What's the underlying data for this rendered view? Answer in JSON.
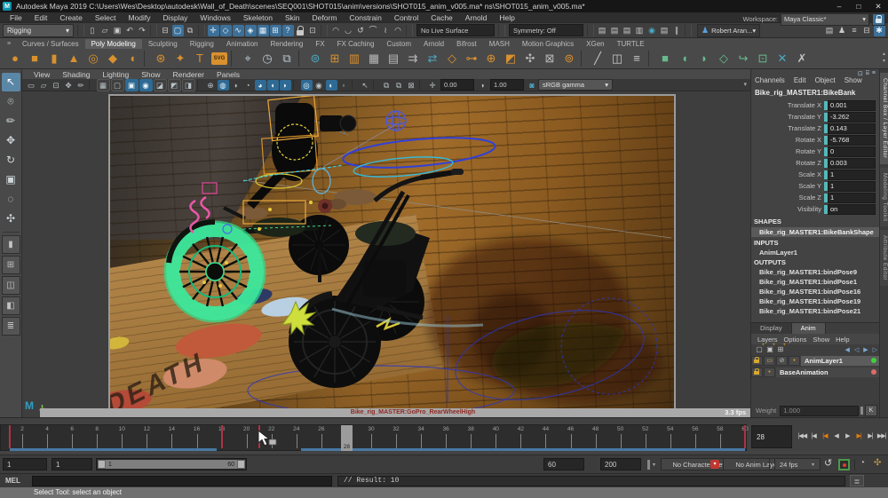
{
  "window": {
    "title": "Autodesk Maya 2019 C:\\Users\\Wes\\Desktop\\autodesk\\Wall_of_Death\\scenes\\SEQ001\\SHOT015\\anim\\versions\\SHOT015_anim_v005.ma*   ns\\SHOT015_anim_v005.ma*",
    "logo_letter": "M",
    "controls": {
      "minimize": "–",
      "maximize": "□",
      "close": "✕"
    }
  },
  "menu_bar": {
    "items": [
      "File",
      "Edit",
      "Create",
      "Select",
      "Modify",
      "Display",
      "Windows",
      "Skeleton",
      "Skin",
      "Deform",
      "Constrain",
      "Control",
      "Cache",
      "Arnold",
      "Help"
    ]
  },
  "workspace": {
    "label": "Workspace:",
    "value": "Maya Classic*",
    "caret": "▾",
    "lock_glyph": "⊓"
  },
  "status_line": {
    "items": [
      {
        "k": "dropdown",
        "name": "menu-set-dropdown",
        "text": "Rigging",
        "w": 70
      },
      {
        "k": "div"
      },
      {
        "k": "icon",
        "name": "new-scene-icon",
        "g": "▯"
      },
      {
        "k": "icon",
        "name": "open-scene-icon",
        "g": "▱"
      },
      {
        "k": "icon",
        "name": "save-scene-icon",
        "g": "▣"
      },
      {
        "k": "icon",
        "name": "undo-icon",
        "g": "↶"
      },
      {
        "k": "icon",
        "name": "redo-icon",
        "g": "↷"
      },
      {
        "k": "div"
      },
      {
        "k": "icon",
        "name": "select-hierarchy-icon",
        "g": "⊟"
      },
      {
        "k": "icon",
        "name": "select-object-icon",
        "g": "▢",
        "active": true
      },
      {
        "k": "icon",
        "name": "select-component-icon",
        "g": "⧉"
      },
      {
        "k": "div"
      },
      {
        "k": "icon",
        "name": "snap-grid-icon",
        "g": "✛",
        "active": true
      },
      {
        "k": "icon",
        "name": "snap-curve-icon",
        "g": "◇",
        "active": true
      },
      {
        "k": "icon",
        "name": "snap-point-icon",
        "g": "∿",
        "active": true
      },
      {
        "k": "icon",
        "name": "snap-plane-icon",
        "g": "◈",
        "active": true
      },
      {
        "k": "icon",
        "name": "snap-view-icon",
        "g": "▦",
        "active": true
      },
      {
        "k": "icon",
        "name": "snap-center-icon",
        "g": "⊞",
        "active": true
      },
      {
        "k": "icon",
        "name": "make-live-icon",
        "g": "?",
        "active": true
      },
      {
        "k": "lock",
        "name": "lock-selection-icon"
      },
      {
        "k": "icon",
        "name": "highlight-selection-icon",
        "g": "⊡"
      },
      {
        "k": "div"
      },
      {
        "k": "icon",
        "name": "construction-history-icon",
        "g": "◠"
      },
      {
        "k": "icon",
        "name": "curve-snap-icon",
        "g": "◡"
      },
      {
        "k": "icon",
        "name": "rebuild-curve-icon",
        "g": "↺"
      },
      {
        "k": "icon",
        "name": "arc-tool-icon",
        "g": "⌒"
      },
      {
        "k": "icon",
        "name": "wave-tool-icon",
        "g": "≀"
      },
      {
        "k": "icon",
        "name": "arch-tool-icon",
        "g": "◠"
      },
      {
        "k": "div"
      },
      {
        "k": "field",
        "name": "live-surface-field",
        "text": "No Live Surface",
        "w": 78
      },
      {
        "k": "div"
      },
      {
        "k": "field",
        "name": "symmetry-field",
        "text": "Symmetry: Off",
        "w": 74
      },
      {
        "k": "div"
      },
      {
        "k": "icon",
        "name": "render-icon",
        "g": "▤"
      },
      {
        "k": "icon",
        "name": "ipr-render-icon",
        "g": "▤"
      },
      {
        "k": "icon",
        "name": "render-settings-icon",
        "g": "▤"
      },
      {
        "k": "icon",
        "name": "hypershade-icon",
        "g": "▥"
      },
      {
        "k": "icon",
        "name": "render-view-sphere-icon",
        "g": "◉",
        "c": "#4aa9c4"
      },
      {
        "k": "icon",
        "name": "render-sequence-icon",
        "g": "▤"
      },
      {
        "k": "icon",
        "name": "pause-viewport-icon",
        "g": "∥"
      },
      {
        "k": "div"
      },
      {
        "k": "user",
        "name": "user-account-chip",
        "text": "Robert Aran...",
        "caret": "▾"
      },
      {
        "k": "flex"
      },
      {
        "k": "icon",
        "name": "outliner-toggle-icon",
        "g": "▤"
      },
      {
        "k": "icon",
        "name": "character-controls-icon",
        "g": "♟"
      },
      {
        "k": "icon",
        "name": "sliders-toggle-icon",
        "g": "≡"
      },
      {
        "k": "icon",
        "name": "layout-toggle-icon",
        "g": "⊟"
      },
      {
        "k": "icon",
        "name": "settings-toggle-icon",
        "g": "✱",
        "active": true
      }
    ]
  },
  "shelf": {
    "burger": "≡",
    "tabs": [
      "Curves / Surfaces",
      "Poly Modeling",
      "Sculpting",
      "Rigging",
      "Animation",
      "Rendering",
      "FX",
      "FX Caching",
      "Custom",
      "Arnold",
      "Bifrost",
      "MASH",
      "Motion Graphics",
      "XGen",
      "TURTLE"
    ],
    "active_tab": "Poly Modeling",
    "scroll_up": "▴",
    "scroll_down": "▾",
    "icons": [
      {
        "n": "poly-sphere-icon",
        "g": "●",
        "c": "#d9912f"
      },
      {
        "n": "poly-cube-icon",
        "g": "■",
        "c": "#d9912f"
      },
      {
        "n": "poly-cylinder-icon",
        "g": "▮",
        "c": "#d9912f"
      },
      {
        "n": "poly-cone-icon",
        "g": "▲",
        "c": "#d9912f"
      },
      {
        "n": "poly-torus-icon",
        "g": "◎",
        "c": "#d9912f"
      },
      {
        "n": "poly-plane-icon",
        "g": "◆",
        "c": "#d9912f"
      },
      {
        "n": "poly-disc-icon",
        "g": "◖",
        "c": "#d9912f"
      },
      {
        "n": "div"
      },
      {
        "n": "platonic-solid-icon",
        "g": "⊛",
        "c": "#d9912f"
      },
      {
        "n": "super-shape-icon",
        "g": "✦",
        "c": "#d9912f"
      },
      {
        "n": "poly-text-icon",
        "g": "T",
        "c": "#d9912f"
      },
      {
        "n": "svg-tool-icon",
        "g": "SVG",
        "badge": true
      },
      {
        "n": "div"
      },
      {
        "n": "construction-plane-icon",
        "g": "⌖",
        "c": "#b8c4cc"
      },
      {
        "n": "snap-time-icon",
        "g": "◷",
        "c": "#b8c4cc"
      },
      {
        "n": "lattice-icon",
        "g": "⧉",
        "c": "#b8c4cc"
      },
      {
        "n": "div"
      },
      {
        "n": "sweep-mesh-icon",
        "g": "⊜",
        "c": "#4aa9c4"
      },
      {
        "n": "quad-draw-icon",
        "g": "⊞",
        "c": "#d9912f"
      },
      {
        "n": "barrel-icon",
        "g": "▥",
        "c": "#d9912f"
      },
      {
        "n": "grid-icon",
        "g": "▦",
        "c": "#b8b8b8"
      },
      {
        "n": "grid-alt-icon",
        "g": "▤",
        "c": "#b8b8b8"
      },
      {
        "n": "uv-icon",
        "g": "⇉",
        "c": "#b8b8b8"
      },
      {
        "n": "mirror-icon",
        "g": "⇄",
        "c": "#4aa9c4"
      },
      {
        "n": "cube-wire-icon",
        "g": "◇",
        "c": "#d9912f"
      },
      {
        "n": "network-icon",
        "g": "⊶",
        "c": "#d9912f"
      },
      {
        "n": "web-icon",
        "g": "⊕",
        "c": "#d9912f"
      },
      {
        "n": "corner-arrow-icon",
        "g": "◩",
        "c": "#d9912f"
      },
      {
        "n": "fan-icon",
        "g": "✣",
        "c": "#b8b8b8"
      },
      {
        "n": "crate-icon",
        "g": "⊠",
        "c": "#b8b8b8"
      },
      {
        "n": "pixel-ball-icon",
        "g": "⊚",
        "c": "#d9912f"
      },
      {
        "n": "div"
      },
      {
        "n": "pencil-line-icon",
        "g": "╱",
        "c": "#c8c8c8"
      },
      {
        "n": "retopo-icon",
        "g": "◫",
        "c": "#c8c8c8"
      },
      {
        "n": "pen-detail-icon",
        "g": "≡",
        "c": "#c8c8c8"
      },
      {
        "n": "div"
      },
      {
        "n": "boolean-union-icon",
        "g": "■",
        "c": "#67b98e"
      },
      {
        "n": "boolean-difference-icon",
        "g": "◖",
        "c": "#67b98e"
      },
      {
        "n": "boolean-intersect-icon",
        "g": "◗",
        "c": "#67b98e"
      },
      {
        "n": "boolean-cube-icon",
        "g": "◇",
        "c": "#67b98e"
      },
      {
        "n": "bend-arrow-icon",
        "g": "↪",
        "c": "#67b98e"
      },
      {
        "n": "framed-square-icon",
        "g": "⊡",
        "c": "#67b98e"
      },
      {
        "n": "multi-cut-icon",
        "g": "✕",
        "c": "#4aa9c4"
      },
      {
        "n": "delete-edge-icon",
        "g": "✗",
        "c": "#c0c0c0"
      }
    ]
  },
  "toolbox": {
    "tools": [
      {
        "name": "select-tool",
        "g": "↖",
        "active": true
      },
      {
        "name": "lasso-select-tool",
        "g": "⌾"
      },
      {
        "name": "paint-select-tool",
        "g": "✏"
      },
      {
        "name": "move-tool",
        "g": "✥"
      },
      {
        "name": "rotate-tool",
        "g": "↻"
      },
      {
        "name": "scale-tool",
        "g": "▣"
      },
      {
        "name": "soft-mod-tool",
        "g": "◌"
      },
      {
        "name": "joint-tool",
        "g": "✣"
      }
    ],
    "layouts": [
      {
        "name": "layout-single-pane",
        "g": "▮"
      },
      {
        "name": "layout-four-pane",
        "g": "⊞"
      },
      {
        "name": "layout-two-pane",
        "g": "◫"
      },
      {
        "name": "layout-outliner-persp",
        "g": "◧"
      },
      {
        "name": "layout-list",
        "g": "≣"
      }
    ]
  },
  "viewport": {
    "menus": [
      "View",
      "Shading",
      "Lighting",
      "Show",
      "Renderer",
      "Panels"
    ],
    "toolbar": [
      {
        "k": "icon",
        "name": "camera-lock-icon",
        "g": "▭"
      },
      {
        "k": "icon",
        "name": "bookmark-icon",
        "g": "▱"
      },
      {
        "k": "icon",
        "name": "image-plane-icon",
        "g": "⊡"
      },
      {
        "k": "icon",
        "name": "pan-zoom-icon",
        "g": "✥"
      },
      {
        "k": "icon",
        "name": "grease-pencil-icon",
        "g": "✏"
      },
      {
        "k": "div"
      },
      {
        "k": "icon",
        "name": "wireframe-mode-icon",
        "g": "▦",
        "boxed": true
      },
      {
        "k": "icon",
        "name": "shaded-mode-icon",
        "g": "▢",
        "boxed": true
      },
      {
        "k": "icon",
        "name": "textured-mode-icon",
        "g": "▣",
        "boxed": true,
        "active": true
      },
      {
        "k": "icon",
        "name": "lit-mode-icon",
        "g": "◉",
        "boxed": true,
        "active": true
      },
      {
        "k": "icon",
        "name": "shadows-mode-icon",
        "g": "◪",
        "boxed": true
      },
      {
        "k": "icon",
        "name": "ao-mode-icon",
        "g": "◩",
        "boxed": true
      },
      {
        "k": "icon",
        "name": "mb-mode-icon",
        "g": "◨",
        "boxed": true
      },
      {
        "k": "div"
      },
      {
        "k": "icon",
        "name": "default-material-icon",
        "g": "⊕"
      },
      {
        "k": "icon",
        "name": "wire-on-shaded-icon",
        "g": "◍",
        "active": true
      },
      {
        "k": "icon",
        "name": "textures-toggle-icon",
        "g": "◑"
      },
      {
        "k": "icon",
        "name": "xray-icon",
        "g": "◔"
      },
      {
        "k": "icon",
        "name": "xray-joints-icon",
        "g": "◕",
        "active": true
      },
      {
        "k": "icon",
        "name": "isolate-select-icon",
        "g": "◖",
        "active": true
      },
      {
        "k": "icon",
        "name": "fog-icon",
        "g": "◗",
        "active": true
      },
      {
        "k": "div"
      },
      {
        "k": "icon",
        "name": "lighting-all-icon",
        "g": "◎",
        "active": true
      },
      {
        "k": "icon",
        "name": "lighting-default-icon",
        "g": "◉"
      },
      {
        "k": "icon",
        "name": "shadow-toggle-icon",
        "g": "◐",
        "active": true
      },
      {
        "k": "icon",
        "name": "ssao-icon",
        "g": "▫"
      },
      {
        "k": "div"
      },
      {
        "k": "icon",
        "name": "object-pick-icon",
        "g": "↖"
      },
      {
        "k": "div"
      },
      {
        "k": "icon",
        "name": "tearoff-copy-icon",
        "g": "⧉"
      },
      {
        "k": "icon",
        "name": "tearoff-icon",
        "g": "⧉"
      },
      {
        "k": "icon",
        "name": "snapshot-icon",
        "g": "⊠"
      },
      {
        "k": "div"
      },
      {
        "k": "icon",
        "name": "exposure-icon",
        "g": "✛"
      },
      {
        "k": "field",
        "name": "exposure-field",
        "text": "0.00",
        "w": 30
      },
      {
        "k": "icon",
        "name": "gain-icon",
        "g": "◑"
      },
      {
        "k": "field",
        "name": "gain-field",
        "text": "1.00",
        "w": 30
      },
      {
        "k": "icon",
        "name": "gamma-icon",
        "g": "◙",
        "c": "#4aa9c4"
      },
      {
        "k": "gamma",
        "name": "gamma-dropdown",
        "text": "sRGB gamma",
        "caret": "▾",
        "w": 74
      }
    ],
    "right_caret": "▾",
    "selection_label": "Bike_rig_MASTER:GoPro_RearWheelHigh",
    "fps": "3.3 fps",
    "logo_letter": "M",
    "scene": {
      "graffiti_text": "DEATH"
    }
  },
  "channel_box": {
    "top_icons": [
      "⊡",
      "⌸",
      "≡"
    ],
    "menus": [
      "Channels",
      "Edit",
      "Object",
      "Show"
    ],
    "node_name": "Bike_rig_MASTER1:BikeBank",
    "attributes": [
      [
        "Translate X",
        "0.001"
      ],
      [
        "Translate Y",
        "-3.262"
      ],
      [
        "Translate Z",
        "0.143"
      ],
      [
        "Rotate X",
        "-5.768"
      ],
      [
        "Rotate Y",
        "0"
      ],
      [
        "Rotate Z",
        "0.003"
      ],
      [
        "Scale X",
        "1"
      ],
      [
        "Scale Y",
        "1"
      ],
      [
        "Scale Z",
        "1"
      ],
      [
        "Visibility",
        "on"
      ]
    ],
    "shapes_header": "SHAPES",
    "shape_name": "Bike_rig_MASTER1:BikeBankShape",
    "inputs_header": "INPUTS",
    "inputs": [
      "AnimLayer1"
    ],
    "outputs_header": "OUTPUTS",
    "outputs": [
      "Bike_rig_MASTER1:bindPose9",
      "Bike_rig_MASTER1:bindPose1",
      "Bike_rig_MASTER1:bindPose16",
      "Bike_rig_MASTER1:bindPose19",
      "Bike_rig_MASTER1:bindPose21"
    ]
  },
  "side_tabs": [
    {
      "label": "Channel Box / Layer Editor",
      "active": true
    },
    {
      "label": "Modeling Toolkit",
      "active": false
    },
    {
      "label": "Attribute Editor",
      "active": false
    }
  ],
  "layer_editor": {
    "tabs": [
      {
        "label": "Display",
        "active": false
      },
      {
        "label": "Anim",
        "active": true
      }
    ],
    "menus": [
      "Layers",
      "Options",
      "Show",
      "Help"
    ],
    "add_icons": [
      {
        "name": "create-empty-layer-icon",
        "g": "▢"
      },
      {
        "name": "create-layer-from-selected-icon",
        "g": "▣"
      },
      {
        "name": "create-override-layer-icon",
        "g": "⊞"
      }
    ],
    "right_icons": [
      {
        "name": "move-layer-up-icon",
        "g": "◀"
      },
      {
        "name": "move-layer-down-icon",
        "g": "◁"
      },
      {
        "name": "zero-key-layer-icon",
        "g": "▶"
      },
      {
        "name": "zero-weight-layer-icon",
        "g": "▷"
      }
    ],
    "layers": [
      {
        "name": "AnimLayer1",
        "selected": true,
        "dot": "#3fd03f",
        "cells": [
          "lock",
          "box",
          "slash",
          "plus"
        ]
      },
      {
        "name": "BaseAnimation",
        "selected": false,
        "dot": "#e06a6a",
        "cells": [
          "lock",
          "plus"
        ]
      }
    ],
    "weight_label": "Weight",
    "weight_value": "1.000",
    "key_button": "K"
  },
  "timeline": {
    "start": 1,
    "end": 60,
    "label_step": 2,
    "current_frame": 28,
    "current_frame_label": "28",
    "keyframes": [
      1,
      18,
      21,
      60
    ],
    "cached_ranges": [
      [
        1,
        17.6
      ],
      [
        24.4,
        60
      ]
    ]
  },
  "playback": {
    "current_frame_field": "28",
    "buttons": [
      {
        "name": "go-to-start-button",
        "g": "|◀◀"
      },
      {
        "name": "step-back-frame-button",
        "g": "|◀"
      },
      {
        "name": "step-back-key-button",
        "g": "|◀",
        "c": "#e87d0d"
      },
      {
        "name": "play-backwards-button",
        "g": "◀"
      },
      {
        "name": "play-forwards-button",
        "g": "▶"
      },
      {
        "name": "step-forward-key-button",
        "g": "▶|",
        "c": "#e87d0d"
      },
      {
        "name": "step-forward-frame-button",
        "g": "▶|"
      },
      {
        "name": "go-to-end-button",
        "g": "▶▶|"
      }
    ]
  },
  "range_bar": {
    "anim_start": "1",
    "playback_start": "1",
    "range_start_label": "1",
    "range_end_label": "60",
    "playback_end": "60",
    "anim_end": "200",
    "character_set": "No Character Set",
    "anim_layer_filter": "No Anim Layer",
    "fps": "24 fps",
    "caret": "▾",
    "loop_glyph": "↺",
    "clock_glyph": "◔",
    "prefs_glyph": "✣"
  },
  "command_line": {
    "label": "MEL",
    "input_value": "",
    "result": "// Result: 10",
    "script_editor_glyph": "≣"
  },
  "help_line": {
    "text": "Select Tool: select an object"
  },
  "colors": {
    "accent_blue": "#3c7098",
    "icon_orange": "#d9912f",
    "key_red": "#b03246",
    "cache_blue": "#4878a2",
    "channel_teal": "#56b8b8",
    "layer_green": "#3fd03f",
    "layer_red": "#e06a6a",
    "green_wheel": "#3ce89c"
  }
}
